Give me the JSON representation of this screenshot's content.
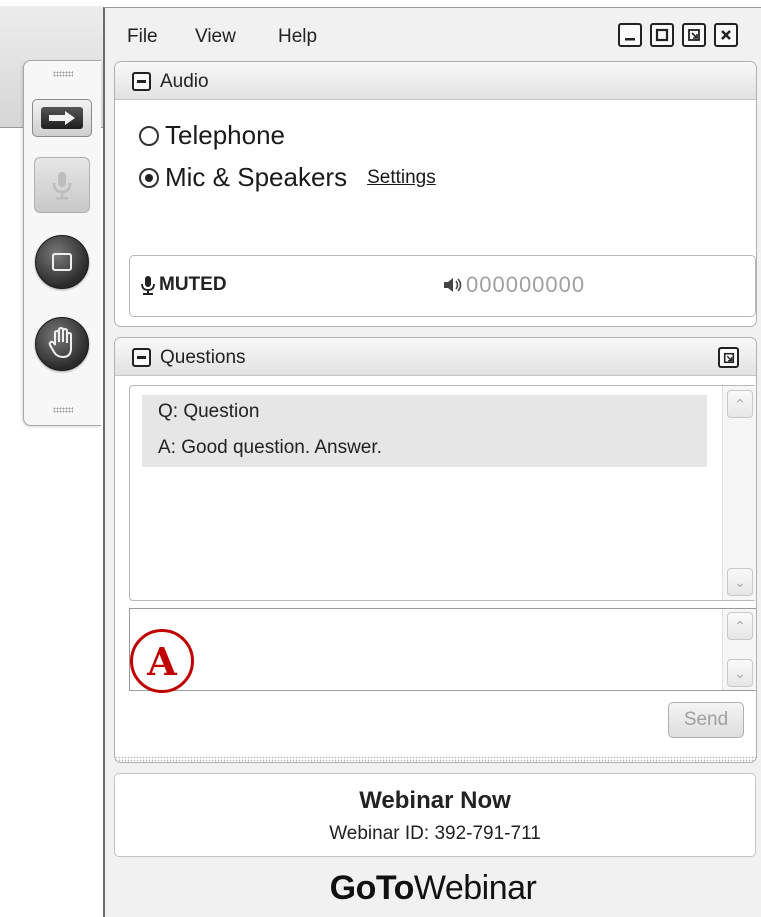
{
  "menu": {
    "items": [
      "File",
      "View",
      "Help"
    ]
  },
  "window_controls": {
    "minimize": "minimize-icon",
    "maximize": "maximize-icon",
    "restore": "restore-icon",
    "close": "close-icon"
  },
  "toolbar": {
    "buttons": [
      {
        "name": "show-hide-panel",
        "icon": "arrow-right-icon"
      },
      {
        "name": "mic",
        "icon": "microphone-icon",
        "state": "disabled"
      },
      {
        "name": "screen-share",
        "icon": "screen-icon"
      },
      {
        "name": "raise-hand",
        "icon": "hand-icon"
      }
    ]
  },
  "audio": {
    "title": "Audio",
    "options": [
      {
        "label": "Telephone",
        "selected": false
      },
      {
        "label": "Mic & Speakers",
        "selected": true
      }
    ],
    "settings_link": "Settings",
    "mic_status": "MUTED",
    "speaker_level": "000000000"
  },
  "questions": {
    "title": "Questions",
    "items": [
      {
        "text": "Q: Question"
      },
      {
        "text": "A: Good question. Answer."
      }
    ],
    "input_value": "",
    "send_label": "Send",
    "marker_label": "A"
  },
  "webinar": {
    "name": "Webinar Now",
    "id_text": "Webinar ID: 392-791-711"
  },
  "brand": {
    "bold": "GoTo",
    "regular": "Webinar"
  },
  "colors": {
    "marker": "#c00000",
    "panel_bg": "#f1f1f1"
  }
}
